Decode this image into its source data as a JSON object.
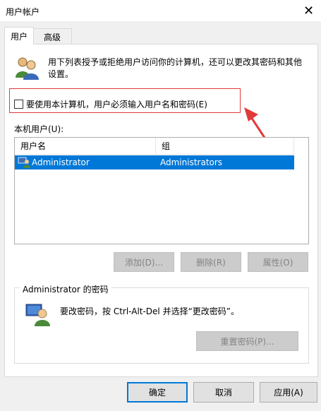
{
  "window": {
    "title": "用户帐户"
  },
  "tabs": [
    {
      "label": "用户",
      "active": true
    },
    {
      "label": "高级",
      "active": false
    }
  ],
  "description": "用下列表授予或拒绝用户访问你的计算机，还可以更改其密码和其他设置。",
  "require_password_label": "要使用本计算机，用户必须输入用户名和密码(E)",
  "require_password_checked": false,
  "users_label": "本机用户(U):",
  "list": {
    "columns": [
      "用户名",
      "组"
    ],
    "rows": [
      {
        "username": "Administrator",
        "group": "Administrators",
        "selected": true
      }
    ]
  },
  "user_buttons": {
    "add": "添加(D)...",
    "remove": "删除(R)",
    "properties": "属性(O)"
  },
  "password_group": {
    "title": "Administrator 的密码",
    "text": "要改密码，按 Ctrl-Alt-Del 并选择“更改密码”。",
    "reset_button": "重置密码(P)..."
  },
  "dialog_buttons": {
    "ok": "确定",
    "cancel": "取消",
    "apply": "应用(A)"
  },
  "colors": {
    "selection": "#0078d7",
    "annotation": "#e03a3a"
  }
}
